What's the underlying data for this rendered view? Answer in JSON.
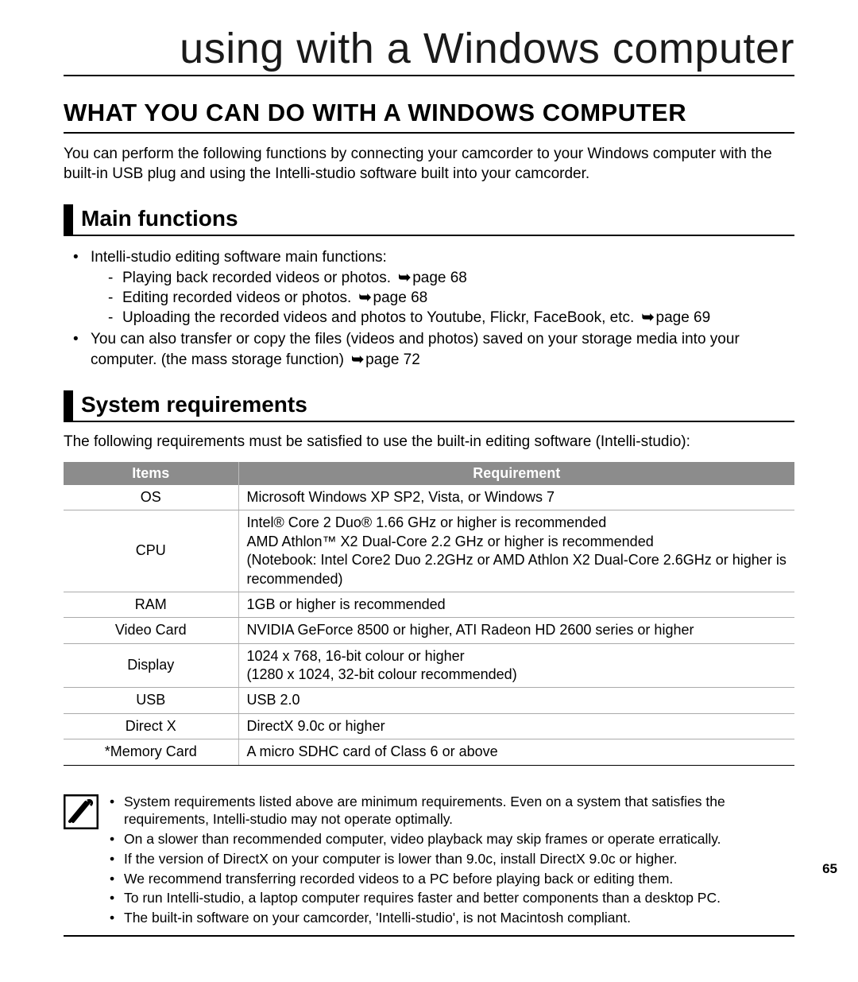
{
  "chapter_title": "using with a Windows computer",
  "section_title": "WHAT YOU CAN DO WITH A WINDOWS COMPUTER",
  "intro": "You can perform the following functions by connecting your camcorder to your Windows computer with the built-in USB plug and using the Intelli-studio software built into your camcorder.",
  "main_functions": {
    "heading": "Main functions",
    "lead": "Intelli-studio editing software main functions:",
    "items": [
      {
        "text": "Playing back recorded videos or photos.",
        "ref": "page 68"
      },
      {
        "text": "Editing recorded videos or photos.",
        "ref": "page 68"
      },
      {
        "text": "Uploading the recorded videos and photos to Youtube, Flickr, FaceBook, etc.",
        "ref": "page 69"
      }
    ],
    "extra_a": "You can also transfer or copy the files (videos and photos) saved on your storage media into your computer. (the mass storage function)",
    "extra_ref": "page 72"
  },
  "system_requirements": {
    "heading": "System requirements",
    "intro": "The following requirements must be satisfied to use the built-in editing software (Intelli-studio):",
    "header_items": "Items",
    "header_req": "Requirement",
    "rows": [
      {
        "item": "OS",
        "req": "Microsoft Windows XP SP2, Vista, or Windows 7"
      },
      {
        "item": "CPU",
        "req": "Intel® Core 2 Duo® 1.66 GHz or higher is recommended\nAMD Athlon™ X2 Dual-Core 2.2 GHz or higher is recommended\n(Notebook: Intel Core2 Duo 2.2GHz or AMD Athlon X2 Dual-Core 2.6GHz or higher is recommended)"
      },
      {
        "item": "RAM",
        "req": "1GB or higher is recommended"
      },
      {
        "item": "Video Card",
        "req": "NVIDIA GeForce 8500 or higher, ATI Radeon HD 2600 series or higher"
      },
      {
        "item": "Display",
        "req": "1024 x 768, 16-bit colour or higher\n(1280 x 1024, 32-bit colour recommended)"
      },
      {
        "item": "USB",
        "req": "USB 2.0"
      },
      {
        "item": "Direct X",
        "req": "DirectX 9.0c or higher"
      },
      {
        "item": "*Memory Card",
        "req": "A micro SDHC card of Class 6 or above"
      }
    ]
  },
  "notes": [
    "System requirements listed above are minimum requirements. Even on a system that satisfies the requirements, Intelli-studio may not operate optimally.",
    "On a slower than recommended computer, video playback may skip frames or operate erratically.",
    "If the version of DirectX on your computer is lower than 9.0c, install DirectX 9.0c or higher.",
    "We recommend transferring recorded videos to a PC before playing back or editing them.",
    "To run Intelli-studio, a laptop computer requires faster and better components than a desktop PC.",
    "The built-in software on your camcorder, 'Intelli-studio', is not Macintosh compliant."
  ],
  "page_number": "65"
}
